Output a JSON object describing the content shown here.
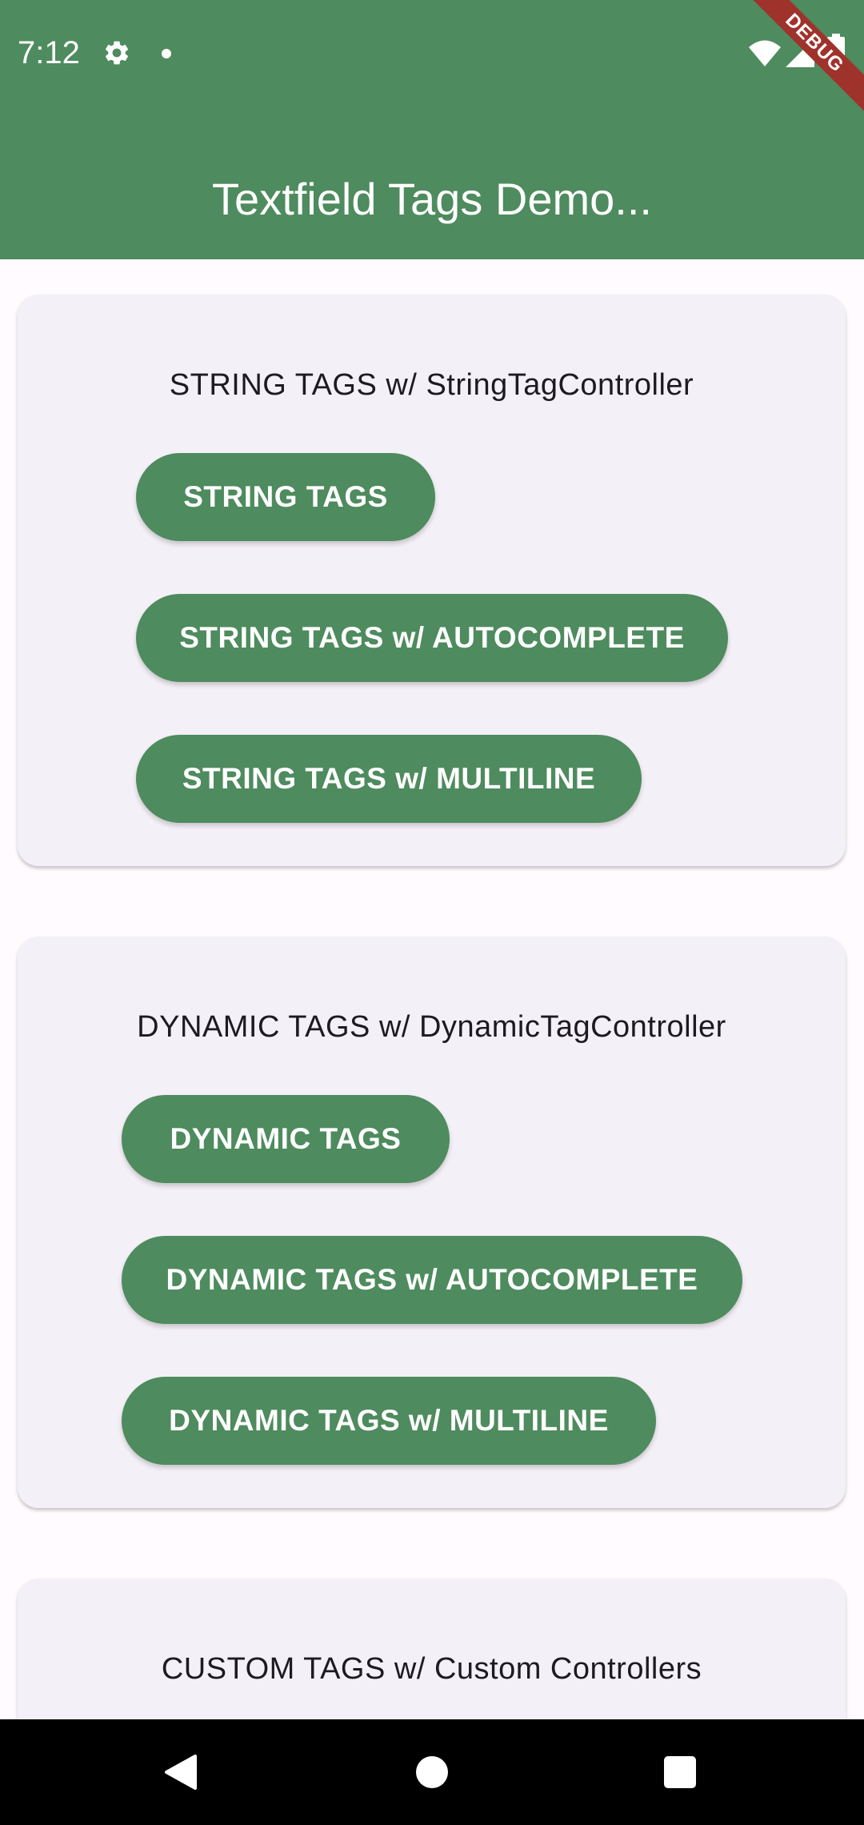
{
  "status_bar": {
    "time": "7:12",
    "icons": [
      "settings-icon",
      "notification-dot-icon",
      "wifi-icon",
      "signal-icon",
      "battery-icon"
    ]
  },
  "debug_banner": "DEBUG",
  "app_bar": {
    "title": "Textfield Tags Demo..."
  },
  "sections": [
    {
      "title": "STRING TAGS w/ StringTagController",
      "buttons": [
        "STRING TAGS",
        "STRING TAGS w/ AUTOCOMPLETE",
        "STRING TAGS w/ MULTILINE"
      ]
    },
    {
      "title": "DYNAMIC TAGS w/ DynamicTagController",
      "buttons": [
        "DYNAMIC TAGS",
        "DYNAMIC TAGS w/ AUTOCOMPLETE",
        "DYNAMIC TAGS w/ MULTILINE"
      ]
    },
    {
      "title": "CUSTOM TAGS w/ Custom Controllers",
      "buttons": [
        ""
      ]
    }
  ],
  "nav_bar": {
    "icons": [
      "back-icon",
      "home-icon",
      "recents-icon"
    ]
  },
  "colors": {
    "primary": "#4e8b5e",
    "card": "#f4f0f7",
    "background": "#fffbfe",
    "debug": "#a0322c"
  }
}
